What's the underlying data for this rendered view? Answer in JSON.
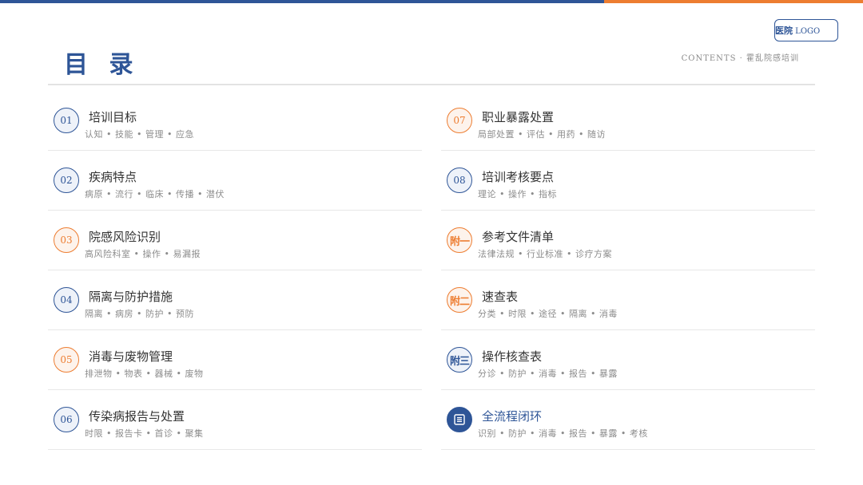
{
  "header": {
    "title": "目 录",
    "subtitle": "CONTENTS · 霍乱院感培训",
    "logo_cn": "医院",
    "logo_en": " LOGO"
  },
  "colors": {
    "primary": "#2e5597",
    "accent": "#ed7d31"
  },
  "items": [
    {
      "num": "01",
      "title": "培训目标",
      "tags": "认知 • 技能 • 管理 • 应急",
      "style": "blue"
    },
    {
      "num": "02",
      "title": "疾病特点",
      "tags": "病原 • 流行 • 临床 • 传播 • 潜伏",
      "style": "blue"
    },
    {
      "num": "03",
      "title": "院感风险识别",
      "tags": "高风险科室 • 操作 • 易漏报",
      "style": "orange"
    },
    {
      "num": "04",
      "title": "隔离与防护措施",
      "tags": "隔离 • 病房 • 防护 • 预防",
      "style": "blue"
    },
    {
      "num": "05",
      "title": "消毒与废物管理",
      "tags": "排泄物 • 物表 • 器械 • 废物",
      "style": "orange"
    },
    {
      "num": "06",
      "title": "传染病报告与处置",
      "tags": "时限 • 报告卡 • 首诊 • 聚集",
      "style": "blue"
    },
    {
      "num": "07",
      "title": "职业暴露处置",
      "tags": "局部处置 • 评估 • 用药 • 随访",
      "style": "orange"
    },
    {
      "num": "08",
      "title": "培训考核要点",
      "tags": "理论 • 操作 • 指标",
      "style": "blue"
    },
    {
      "num": "附一",
      "title": "参考文件清单",
      "tags": "法律法规 • 行业标准 • 诊疗方案",
      "style": "orange"
    },
    {
      "num": "附二",
      "title": "速查表",
      "tags": "分类 • 时限 • 途径 • 隔离 • 消毒",
      "style": "orange"
    },
    {
      "num": "附三",
      "title": "操作核查表",
      "tags": "分诊 • 防护 • 消毒 • 报告 • 暴露",
      "style": "blue"
    },
    {
      "num": "",
      "title": "全流程闭环",
      "tags": "识别 • 防护 • 消毒 • 报告 • 暴露 • 考核",
      "style": "solid",
      "icon": "list-icon"
    }
  ]
}
